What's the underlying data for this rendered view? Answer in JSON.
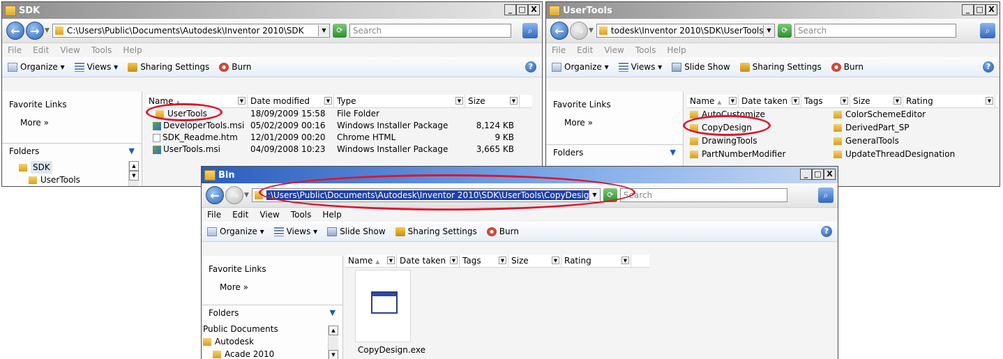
{
  "win_sdk": {
    "title": "SDK",
    "controls": {
      "minimize": "_",
      "maximize": "□",
      "close": "X"
    },
    "address": "C:\\Users\\Public\\Documents\\Autodesk\\Inventor 2010\\SDK",
    "search_placeholder": "Search",
    "menu": [
      "File",
      "Edit",
      "View",
      "Tools",
      "Help"
    ],
    "toolbar": {
      "organize": "Organize ▾",
      "views": "Views ▾",
      "sharing": "Sharing Settings",
      "burn": "Burn"
    },
    "favorite_links": "Favorite Links",
    "more": "More »",
    "folders": "Folders",
    "tree": [
      "SDK",
      "UserTools"
    ],
    "columns": [
      "Name",
      "Date modified",
      "Type",
      "Size"
    ],
    "files": [
      {
        "name": "UserTools",
        "date": "18/09/2009 15:58",
        "type": "File Folder",
        "size": "",
        "icon": "folder-icon"
      },
      {
        "name": "DeveloperTools.msi",
        "date": "05/02/2009 00:16",
        "type": "Windows Installer Package",
        "size": "8,124 KB",
        "icon": "msi-icon"
      },
      {
        "name": "SDK_Readme.htm",
        "date": "12/01/2009 00:20",
        "type": "Chrome HTML",
        "size": "9 KB",
        "icon": "html-file-icon"
      },
      {
        "name": "UserTools.msi",
        "date": "04/09/2008 10:23",
        "type": "Windows Installer Package",
        "size": "3,665 KB",
        "icon": "msi-icon"
      }
    ]
  },
  "win_usertools": {
    "title": "UserTools",
    "controls": {
      "minimize": "_",
      "maximize": "□",
      "close": "X"
    },
    "address": "todesk\\Inventor 2010\\SDK\\UserTools",
    "search_placeholder": "Search",
    "menu": [
      "File",
      "Edit",
      "View",
      "Tools",
      "Help"
    ],
    "toolbar": {
      "organize": "Organize ▾",
      "views": "Views ▾",
      "slideshow": "Slide Show",
      "sharing": "Sharing Settings",
      "burn": "Burn"
    },
    "favorite_links": "Favorite Links",
    "more": "More »",
    "folders": "Folders",
    "columns": [
      "Name",
      "Date taken",
      "Tags",
      "Size",
      "Rating"
    ],
    "items": [
      "AutoCustomize",
      "ColorSchemeEditor",
      "CopyDesign",
      "DerivedPart_SP",
      "DrawingTools",
      "GeneralTools",
      "PartNumberModifier",
      "UpdateThreadDesignation"
    ]
  },
  "win_bin": {
    "title": "Bin",
    "controls": {
      "minimize": "_",
      "maximize": "□",
      "close": "X"
    },
    "address": ":\\Users\\Public\\Documents\\Autodesk\\Inventor 2010\\SDK\\UserTools\\CopyDesign\\Bin",
    "search_placeholder": "Search",
    "menu": [
      "File",
      "Edit",
      "View",
      "Tools",
      "Help"
    ],
    "toolbar": {
      "organize": "Organize ▾",
      "views": "Views ▾",
      "slideshow": "Slide Show",
      "sharing": "Sharing Settings",
      "burn": "Burn"
    },
    "favorite_links": "Favorite Links",
    "more": "More »",
    "folders": "Folders",
    "tree": [
      "Public Documents",
      "Autodesk",
      "Acade 2010"
    ],
    "columns": [
      "Name",
      "Date taken",
      "Tags",
      "Size",
      "Rating"
    ],
    "file": "CopyDesign.exe"
  },
  "colors": {
    "highlight_circle": "#e0142b",
    "titlebar_active": "#2a5dbd",
    "address_selected": "#1f3fa8"
  }
}
